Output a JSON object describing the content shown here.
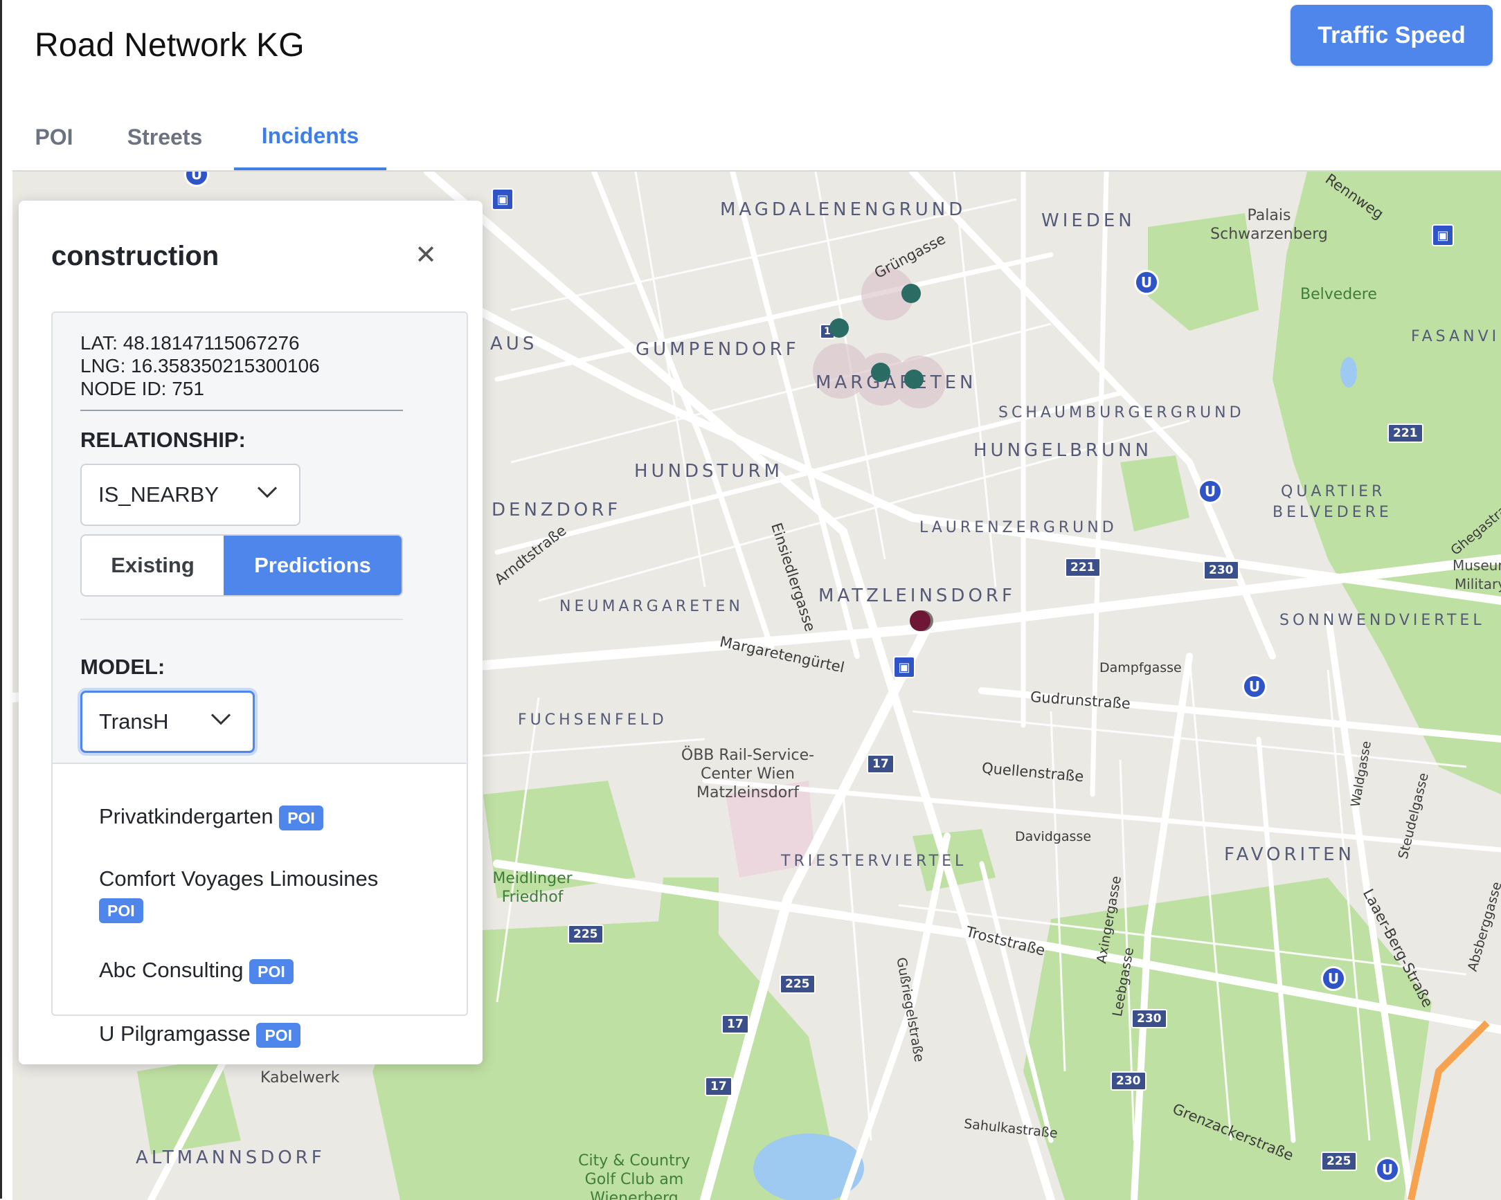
{
  "app": {
    "title": "Road Network KG",
    "traffic_button": "Traffic Speed"
  },
  "tabs": [
    {
      "label": "POI",
      "active": false
    },
    {
      "label": "Streets",
      "active": false
    },
    {
      "label": "Incidents",
      "active": true
    }
  ],
  "panel": {
    "title": "construction",
    "lat": "LAT: 48.18147115067276",
    "lng": "LNG: 16.358350215300106",
    "node_id": "NODE ID: 751",
    "relationship_label": "RELATIONSHIP:",
    "relationship_value": "IS_NEARBY",
    "existing_label": "Existing",
    "predictions_label": "Predictions",
    "model_label": "MODEL:",
    "model_value": "TransH",
    "results": [
      {
        "name": "Privatkindergarten",
        "badge": "POI"
      },
      {
        "name": "Comfort Voyages Limousines",
        "badge": "POI"
      },
      {
        "name": "Abc Consulting",
        "badge": "POI"
      },
      {
        "name": "U Pilgramgasse",
        "badge": "POI"
      }
    ]
  },
  "map": {
    "districts": [
      "MAGDALENENGRUND",
      "WIEDEN",
      "GUMPENDORF",
      "MARGARETEN",
      "SCHAUMBURGERGRUND",
      "HUNGELBRUNN",
      "HUNDSTURM",
      "LAURENZERGRUND",
      "DENZDORF",
      "QUARTIER",
      "BELVEDERE",
      "MATZLEINSDORF",
      "NEUMARGARETEN",
      "SONNWENDVIERTEL",
      "FUCHSENFELD",
      "TRIESTERVIERTEL",
      "FAVORITEN",
      "ALTMANNSDORF",
      "FASANVIE",
      "AUS"
    ],
    "streets": [
      "Grüngasse",
      "Rennweg",
      "Arndtstraße",
      "Einsiedlergasse",
      "Margaretengürtel",
      "Gudrunstraße",
      "Quellenstraße",
      "Davidgasse",
      "Troststraße",
      "Gußriegelstraße",
      "Axingergasse",
      "Leebgasse",
      "Sahulkastraße",
      "Grenzackerstraße",
      "Laaer-Berg-Straße",
      "Steudelgasse",
      "Waldgasse",
      "Dampfgasse",
      "Ghegastraße",
      "Absberggasse"
    ],
    "pois": [
      "Palais Schwarzenberg",
      "Belvedere",
      "ÖBB Rail-Service-Center Wien Matzleinsdorf",
      "Meidlinger Friedhof",
      "Kabelwerk",
      "City & Country Golf Club am Wienerberg",
      "Museum Military"
    ],
    "road_numbers": [
      "221",
      "221",
      "230",
      "17",
      "225",
      "225",
      "17",
      "17",
      "230",
      "230",
      "225",
      "1"
    ],
    "incidents": [
      {
        "type": "construction",
        "color": "#2a6b64"
      },
      {
        "type": "construction",
        "color": "#2a6b64"
      },
      {
        "type": "construction",
        "color": "#2a6b64"
      },
      {
        "type": "construction",
        "color": "#2a6b64"
      },
      {
        "type": "construction",
        "color": "#6e1636",
        "selected": true
      }
    ]
  },
  "colors": {
    "accent": "#4f86ec",
    "park": "#bfe0a3",
    "water": "#9ec9f0",
    "incident": "#2a6b64",
    "selected_incident": "#6e1636"
  }
}
